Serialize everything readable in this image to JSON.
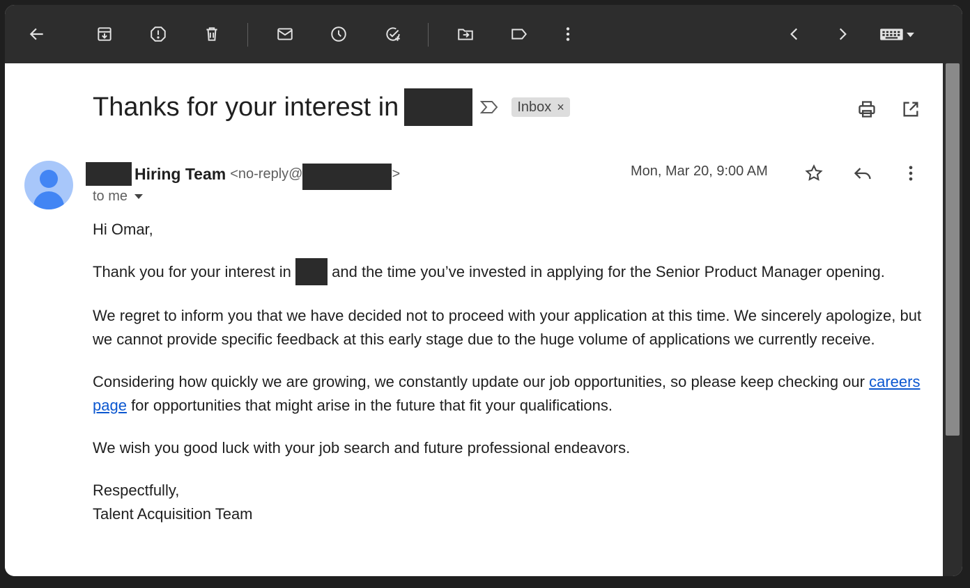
{
  "toolbar": {
    "left_icons": [
      "back-arrow-icon",
      "archive-icon",
      "report-spam-icon",
      "delete-icon",
      "mark-unread-icon",
      "snooze-icon",
      "add-to-tasks-icon",
      "move-to-icon",
      "labels-icon",
      "more-vert-icon"
    ],
    "right_icons": [
      "chevron-left-icon",
      "chevron-right-icon",
      "keyboard-icon"
    ]
  },
  "email": {
    "subject": "Thanks for your interest in",
    "label": "Inbox",
    "label_close": "×",
    "sender_name": "Hiring Team",
    "sender_email_prefix": "<no-reply@",
    "sender_email_suffix": ">",
    "recipient": "to me",
    "date": "Mon, Mar 20, 9:00 AM",
    "body": {
      "greeting": "Hi Omar,",
      "p1_before": "Thank you for your interest in ",
      "p1_after": " and the time you’ve invested in applying for the Senior Product Manager opening.",
      "p2": "We regret to inform you that we have decided not to proceed with your application at this time. We sincerely apologize, but we cannot provide specific feedback at this early stage due to the huge volume of applications we currently receive.",
      "p3_before": "Considering how quickly we are growing, we constantly update our job opportunities, so please keep checking our ",
      "p3_link": "careers page",
      "p3_after": " for opportunities that might arise in the future that fit your qualifications.",
      "p4": "We wish you good luck with your job search and future professional endeavors.",
      "closing": "Respectfully,",
      "signature": "Talent Acquisition Team"
    }
  },
  "colors": {
    "toolbar_bg": "#2d2d2d",
    "link": "#0b57d0",
    "avatar_bg": "#a8c7fa",
    "avatar_fg": "#4285f4"
  }
}
